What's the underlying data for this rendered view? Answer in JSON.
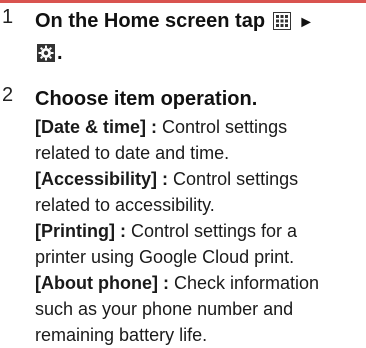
{
  "step1": {
    "number": "1",
    "text_before": "On the Home screen tap",
    "apps_icon": "apps-grid-icon",
    "arrow": "►",
    "settings_icon": "settings-gear-icon",
    "period": "."
  },
  "step2": {
    "number": "2",
    "heading": "Choose item operation.",
    "items": [
      {
        "term": "[Date & time] :",
        "desc_1": " Control settings",
        "desc_2": "related to date and time."
      },
      {
        "term": "[Accessibility] :",
        "desc_1": " Control settings",
        "desc_2": "related to accessibility."
      },
      {
        "term": "[Printing] :",
        "desc_1": " Control settings for a",
        "desc_2": "printer using Google Cloud print."
      },
      {
        "term": "[About phone] :",
        "desc_1": " Check information",
        "desc_2": "such as your phone number and",
        "desc_3": "remaining battery life."
      }
    ]
  },
  "colors": {
    "rule": "#d9534f",
    "text": "#1a1a1a"
  }
}
